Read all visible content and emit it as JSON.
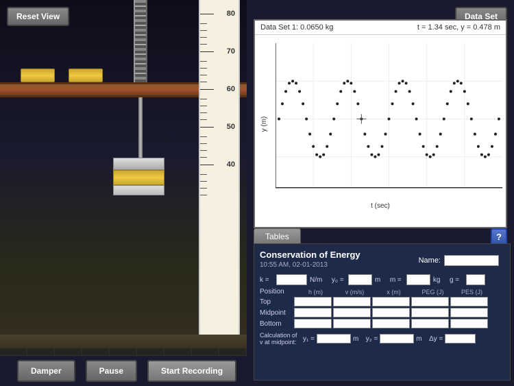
{
  "buttons": {
    "reset_view": "Reset View",
    "data_set": "Data Set",
    "tables_tab": "Tables",
    "help": "?",
    "damper": "Damper",
    "pause": "Pause",
    "start_recording": "Start Recording"
  },
  "graph": {
    "dataset_label": "Data Set 1: 0.0650 kg",
    "time_position": "t = 1.34 sec, y = 0.478 m",
    "y_axis_label": "y (m)",
    "x_axis_label": "t (sec)"
  },
  "data_panel": {
    "title": "Conservation of Energy",
    "timestamp": "10:55 AM, 02-01-2013",
    "name_label": "Name:",
    "k_label": "k =",
    "k_unit": "N/m",
    "y0_label": "y₀ =",
    "y0_unit": "m",
    "m_label": "m =",
    "m_unit": "kg",
    "g_label": "g =",
    "position_label": "Position",
    "h_label": "h (m)",
    "v_label": "v (m/s)",
    "x_label": "x (m)",
    "peg_label": "PEG (J)",
    "pes_label": "PES (J)",
    "top_label": "Top",
    "midpoint_label": "Midpoint",
    "bottom_label": "Bottom",
    "calc_label": "Calculation of",
    "calc_sub": "v at midpoint:",
    "y1_label": "y₁ =",
    "y1_unit": "m",
    "y2_label": "y₂ =",
    "y2_unit": "m",
    "delta_y_label": "Δy ="
  },
  "ruler": {
    "marks": [
      80,
      70,
      60,
      50,
      40
    ]
  }
}
